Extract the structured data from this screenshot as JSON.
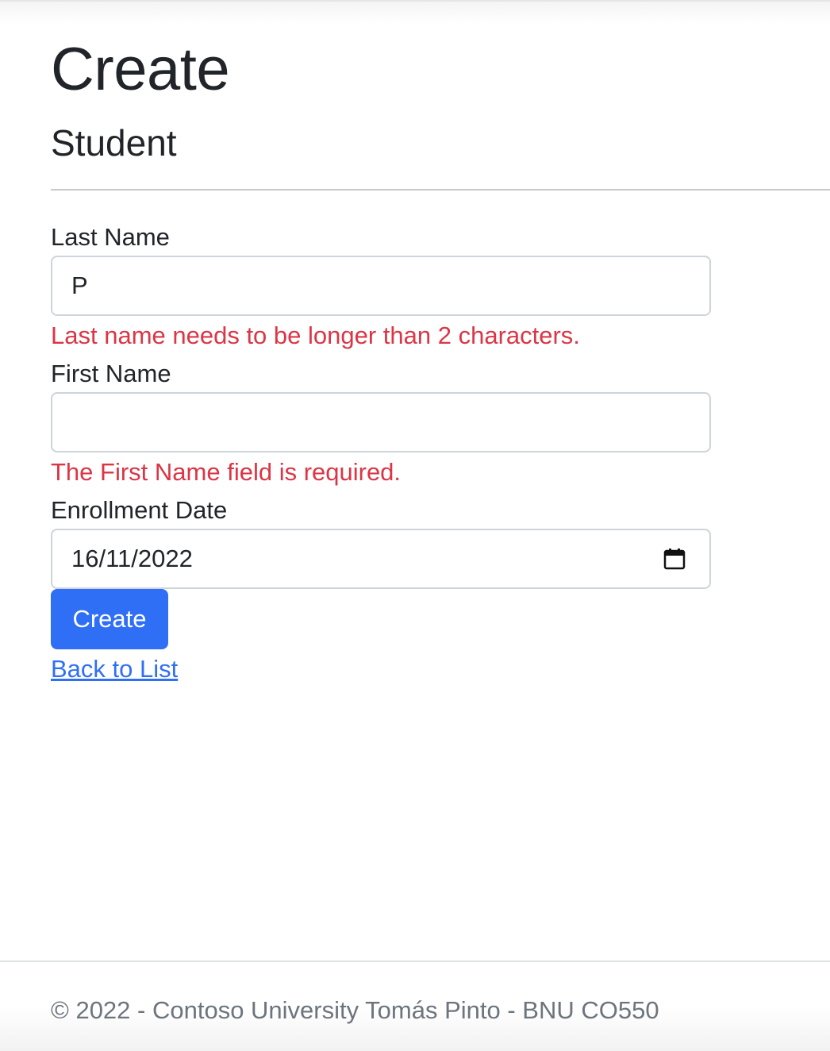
{
  "header": {
    "title": "Create",
    "subtitle": "Student"
  },
  "form": {
    "last_name": {
      "label": "Last Name",
      "value": "P",
      "error": "Last name needs to be longer than 2 characters."
    },
    "first_name": {
      "label": "First Name",
      "value": "",
      "error": "The First Name field is required."
    },
    "enrollment_date": {
      "label": "Enrollment Date",
      "value": "16/11/2022"
    },
    "submit_label": "Create"
  },
  "links": {
    "back": "Back to List"
  },
  "footer": {
    "text": "© 2022 - Contoso University Tomás Pinto - BNU CO550"
  },
  "colors": {
    "primary": "#2f6ff5",
    "error": "#dc3545",
    "muted": "#6c757d"
  }
}
